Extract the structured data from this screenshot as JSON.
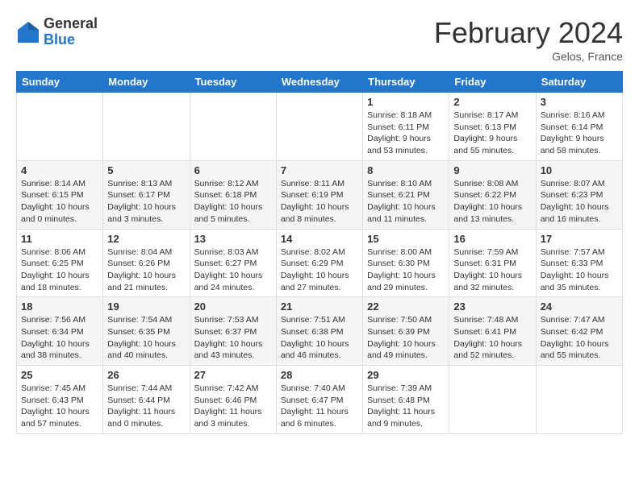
{
  "header": {
    "logo_general": "General",
    "logo_blue": "Blue",
    "month_title": "February 2024",
    "location": "Gelos, France"
  },
  "days_of_week": [
    "Sunday",
    "Monday",
    "Tuesday",
    "Wednesday",
    "Thursday",
    "Friday",
    "Saturday"
  ],
  "weeks": [
    [
      {
        "day": "",
        "info": ""
      },
      {
        "day": "",
        "info": ""
      },
      {
        "day": "",
        "info": ""
      },
      {
        "day": "",
        "info": ""
      },
      {
        "day": "1",
        "info": "Sunrise: 8:18 AM\nSunset: 6:11 PM\nDaylight: 9 hours\nand 53 minutes."
      },
      {
        "day": "2",
        "info": "Sunrise: 8:17 AM\nSunset: 6:13 PM\nDaylight: 9 hours\nand 55 minutes."
      },
      {
        "day": "3",
        "info": "Sunrise: 8:16 AM\nSunset: 6:14 PM\nDaylight: 9 hours\nand 58 minutes."
      }
    ],
    [
      {
        "day": "4",
        "info": "Sunrise: 8:14 AM\nSunset: 6:15 PM\nDaylight: 10 hours\nand 0 minutes."
      },
      {
        "day": "5",
        "info": "Sunrise: 8:13 AM\nSunset: 6:17 PM\nDaylight: 10 hours\nand 3 minutes."
      },
      {
        "day": "6",
        "info": "Sunrise: 8:12 AM\nSunset: 6:18 PM\nDaylight: 10 hours\nand 5 minutes."
      },
      {
        "day": "7",
        "info": "Sunrise: 8:11 AM\nSunset: 6:19 PM\nDaylight: 10 hours\nand 8 minutes."
      },
      {
        "day": "8",
        "info": "Sunrise: 8:10 AM\nSunset: 6:21 PM\nDaylight: 10 hours\nand 11 minutes."
      },
      {
        "day": "9",
        "info": "Sunrise: 8:08 AM\nSunset: 6:22 PM\nDaylight: 10 hours\nand 13 minutes."
      },
      {
        "day": "10",
        "info": "Sunrise: 8:07 AM\nSunset: 6:23 PM\nDaylight: 10 hours\nand 16 minutes."
      }
    ],
    [
      {
        "day": "11",
        "info": "Sunrise: 8:06 AM\nSunset: 6:25 PM\nDaylight: 10 hours\nand 18 minutes."
      },
      {
        "day": "12",
        "info": "Sunrise: 8:04 AM\nSunset: 6:26 PM\nDaylight: 10 hours\nand 21 minutes."
      },
      {
        "day": "13",
        "info": "Sunrise: 8:03 AM\nSunset: 6:27 PM\nDaylight: 10 hours\nand 24 minutes."
      },
      {
        "day": "14",
        "info": "Sunrise: 8:02 AM\nSunset: 6:29 PM\nDaylight: 10 hours\nand 27 minutes."
      },
      {
        "day": "15",
        "info": "Sunrise: 8:00 AM\nSunset: 6:30 PM\nDaylight: 10 hours\nand 29 minutes."
      },
      {
        "day": "16",
        "info": "Sunrise: 7:59 AM\nSunset: 6:31 PM\nDaylight: 10 hours\nand 32 minutes."
      },
      {
        "day": "17",
        "info": "Sunrise: 7:57 AM\nSunset: 6:33 PM\nDaylight: 10 hours\nand 35 minutes."
      }
    ],
    [
      {
        "day": "18",
        "info": "Sunrise: 7:56 AM\nSunset: 6:34 PM\nDaylight: 10 hours\nand 38 minutes."
      },
      {
        "day": "19",
        "info": "Sunrise: 7:54 AM\nSunset: 6:35 PM\nDaylight: 10 hours\nand 40 minutes."
      },
      {
        "day": "20",
        "info": "Sunrise: 7:53 AM\nSunset: 6:37 PM\nDaylight: 10 hours\nand 43 minutes."
      },
      {
        "day": "21",
        "info": "Sunrise: 7:51 AM\nSunset: 6:38 PM\nDaylight: 10 hours\nand 46 minutes."
      },
      {
        "day": "22",
        "info": "Sunrise: 7:50 AM\nSunset: 6:39 PM\nDaylight: 10 hours\nand 49 minutes."
      },
      {
        "day": "23",
        "info": "Sunrise: 7:48 AM\nSunset: 6:41 PM\nDaylight: 10 hours\nand 52 minutes."
      },
      {
        "day": "24",
        "info": "Sunrise: 7:47 AM\nSunset: 6:42 PM\nDaylight: 10 hours\nand 55 minutes."
      }
    ],
    [
      {
        "day": "25",
        "info": "Sunrise: 7:45 AM\nSunset: 6:43 PM\nDaylight: 10 hours\nand 57 minutes."
      },
      {
        "day": "26",
        "info": "Sunrise: 7:44 AM\nSunset: 6:44 PM\nDaylight: 11 hours\nand 0 minutes."
      },
      {
        "day": "27",
        "info": "Sunrise: 7:42 AM\nSunset: 6:46 PM\nDaylight: 11 hours\nand 3 minutes."
      },
      {
        "day": "28",
        "info": "Sunrise: 7:40 AM\nSunset: 6:47 PM\nDaylight: 11 hours\nand 6 minutes."
      },
      {
        "day": "29",
        "info": "Sunrise: 7:39 AM\nSunset: 6:48 PM\nDaylight: 11 hours\nand 9 minutes."
      },
      {
        "day": "",
        "info": ""
      },
      {
        "day": "",
        "info": ""
      }
    ]
  ]
}
